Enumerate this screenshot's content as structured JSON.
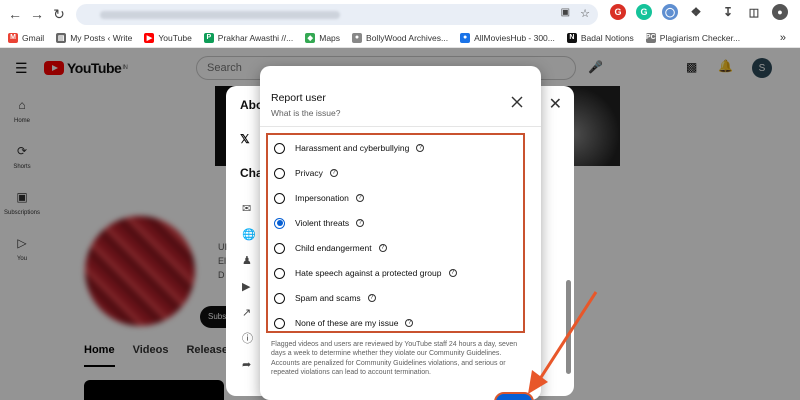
{
  "browser": {
    "bookmarks": [
      {
        "label": "Gmail",
        "color": "#ea4335",
        "glyph": "M"
      },
      {
        "label": "My Posts ‹ Write",
        "color": "#666666",
        "glyph": "▤"
      },
      {
        "label": "YouTube",
        "color": "#ff0000",
        "glyph": "▶"
      },
      {
        "label": "Prakhar Awasthi //...",
        "color": "#0f9d58",
        "glyph": "P"
      },
      {
        "label": "Maps",
        "color": "#34a853",
        "glyph": "◆"
      },
      {
        "label": "BollyWood Archives...",
        "color": "#888888",
        "glyph": "●"
      },
      {
        "label": "AllMoviesHub - 300...",
        "color": "#1a73e8",
        "glyph": "●"
      },
      {
        "label": "Badal Notions",
        "color": "#111111",
        "glyph": "N"
      },
      {
        "label": "Plagiarism Checker...",
        "color": "#777777",
        "glyph": "PC"
      }
    ]
  },
  "youtube": {
    "logo_text": "YouTube",
    "logo_region": "IN",
    "search_placeholder": "Search",
    "avatar_letter": "S",
    "sidebar": [
      {
        "label": "Home",
        "icon": "⌂"
      },
      {
        "label": "Shorts",
        "icon": "⟳"
      },
      {
        "label": "Subscriptions",
        "icon": "▣"
      },
      {
        "label": "You",
        "icon": "▷"
      }
    ],
    "tabs": [
      "Home",
      "Videos",
      "Releases"
    ],
    "about_title": "Abo",
    "about_heading": "Cha",
    "about_fragments": [
      "UI",
      "El",
      "D"
    ],
    "subscribe_fragment": "Subs"
  },
  "report_dialog": {
    "title": "Report user",
    "subtitle": "What is the issue?",
    "options": [
      {
        "label": "Harassment and cyberbullying",
        "selected": false
      },
      {
        "label": "Privacy",
        "selected": false
      },
      {
        "label": "Impersonation",
        "selected": false
      },
      {
        "label": "Violent threats",
        "selected": true
      },
      {
        "label": "Child endangerment",
        "selected": false
      },
      {
        "label": "Hate speech against a protected group",
        "selected": false
      },
      {
        "label": "Spam and scams",
        "selected": false
      },
      {
        "label": "None of these are my issue",
        "selected": false
      }
    ],
    "disclaimer": "Flagged videos and users are reviewed by YouTube staff 24 hours a day, seven days a week to determine whether they violate our Community Guidelines. Accounts are penalized for Community Guidelines violations, and serious or repeated violations can lead to account termination.",
    "accent_color": "#065fd4",
    "highlight_color": "#c9522f"
  }
}
